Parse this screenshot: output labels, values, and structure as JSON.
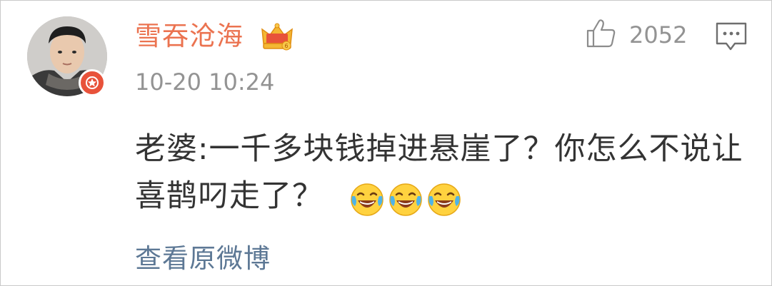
{
  "comment": {
    "username": "雪吞沧海",
    "timestamp": "10-20 10:24",
    "like_count": "2052",
    "text": "老婆:一千多块钱掉进悬崖了？你怎么不说让喜鹊叼走了？",
    "view_original_label": "查看原微博"
  },
  "colors": {
    "username": "#eb7350",
    "link": "#5d7895",
    "meta": "#939393",
    "badge": "#e8523a"
  },
  "icons": {
    "avatar_badge": "verified-badge-icon",
    "vip": "crown-icon",
    "like": "thumbs-up-icon",
    "comment": "comment-bubble-icon",
    "emoji": "laughing-tears-emoji"
  }
}
